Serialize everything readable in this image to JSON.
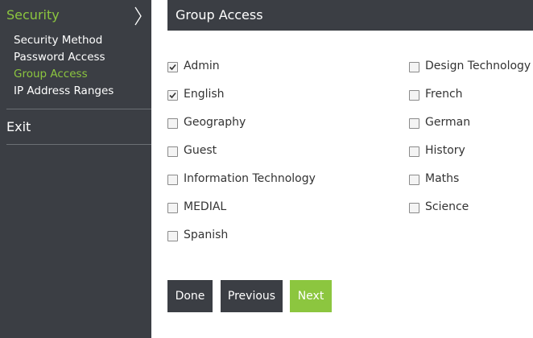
{
  "sidebar": {
    "section_title": "Security",
    "chevron_icon": "chevron-right-icon",
    "items": [
      {
        "label": "Security Method",
        "active": false
      },
      {
        "label": "Password Access",
        "active": false
      },
      {
        "label": "Group Access",
        "active": true
      },
      {
        "label": "IP Address Ranges",
        "active": false
      }
    ],
    "exit_label": "Exit"
  },
  "header": {
    "title": "Group Access"
  },
  "groups": [
    {
      "label": "Admin",
      "checked": true
    },
    {
      "label": "English",
      "checked": true
    },
    {
      "label": "Geography",
      "checked": false
    },
    {
      "label": "Guest",
      "checked": false
    },
    {
      "label": "Information Technology",
      "checked": false
    },
    {
      "label": "MEDIAL",
      "checked": false
    },
    {
      "label": "Spanish",
      "checked": false
    },
    {
      "label": "Design Technology",
      "checked": false
    },
    {
      "label": "French",
      "checked": false
    },
    {
      "label": "German",
      "checked": false
    },
    {
      "label": "History",
      "checked": false
    },
    {
      "label": "Maths",
      "checked": false
    },
    {
      "label": "Science",
      "checked": false
    }
  ],
  "buttons": {
    "done": "Done",
    "previous": "Previous",
    "next": "Next"
  },
  "colors": {
    "accent": "#8cc63f",
    "dark": "#3b3e44"
  }
}
